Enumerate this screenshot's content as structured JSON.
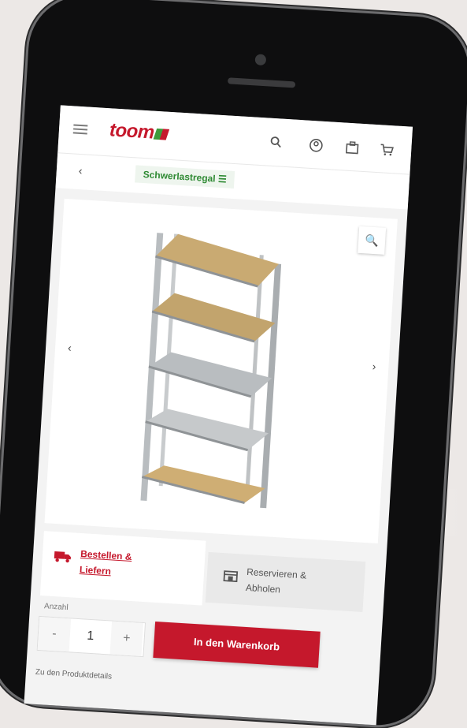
{
  "app": {
    "logo_text": "toom",
    "brand_color": "#c5182c",
    "accent_color": "#2f8a34"
  },
  "header": {
    "icons": [
      "menu-icon",
      "search-icon",
      "account-icon",
      "store-icon",
      "cart-icon"
    ]
  },
  "nav": {
    "back_icon": "chevron-left-icon",
    "breadcrumb": "Schwerlastregal"
  },
  "gallery": {
    "zoom_icon": "magnifier-icon",
    "prev_icon": "chevron-left-icon",
    "next_icon": "chevron-right-icon"
  },
  "purchase_options": {
    "delivery_label": "Bestellen & Liefern",
    "pickup_label": "Reservieren & Abholen"
  },
  "quantity": {
    "label": "Anzahl",
    "minus": "-",
    "value": "1",
    "plus": "+"
  },
  "cart_button": "In den Warenkorb",
  "details_link": "Zu den Produktdetails"
}
